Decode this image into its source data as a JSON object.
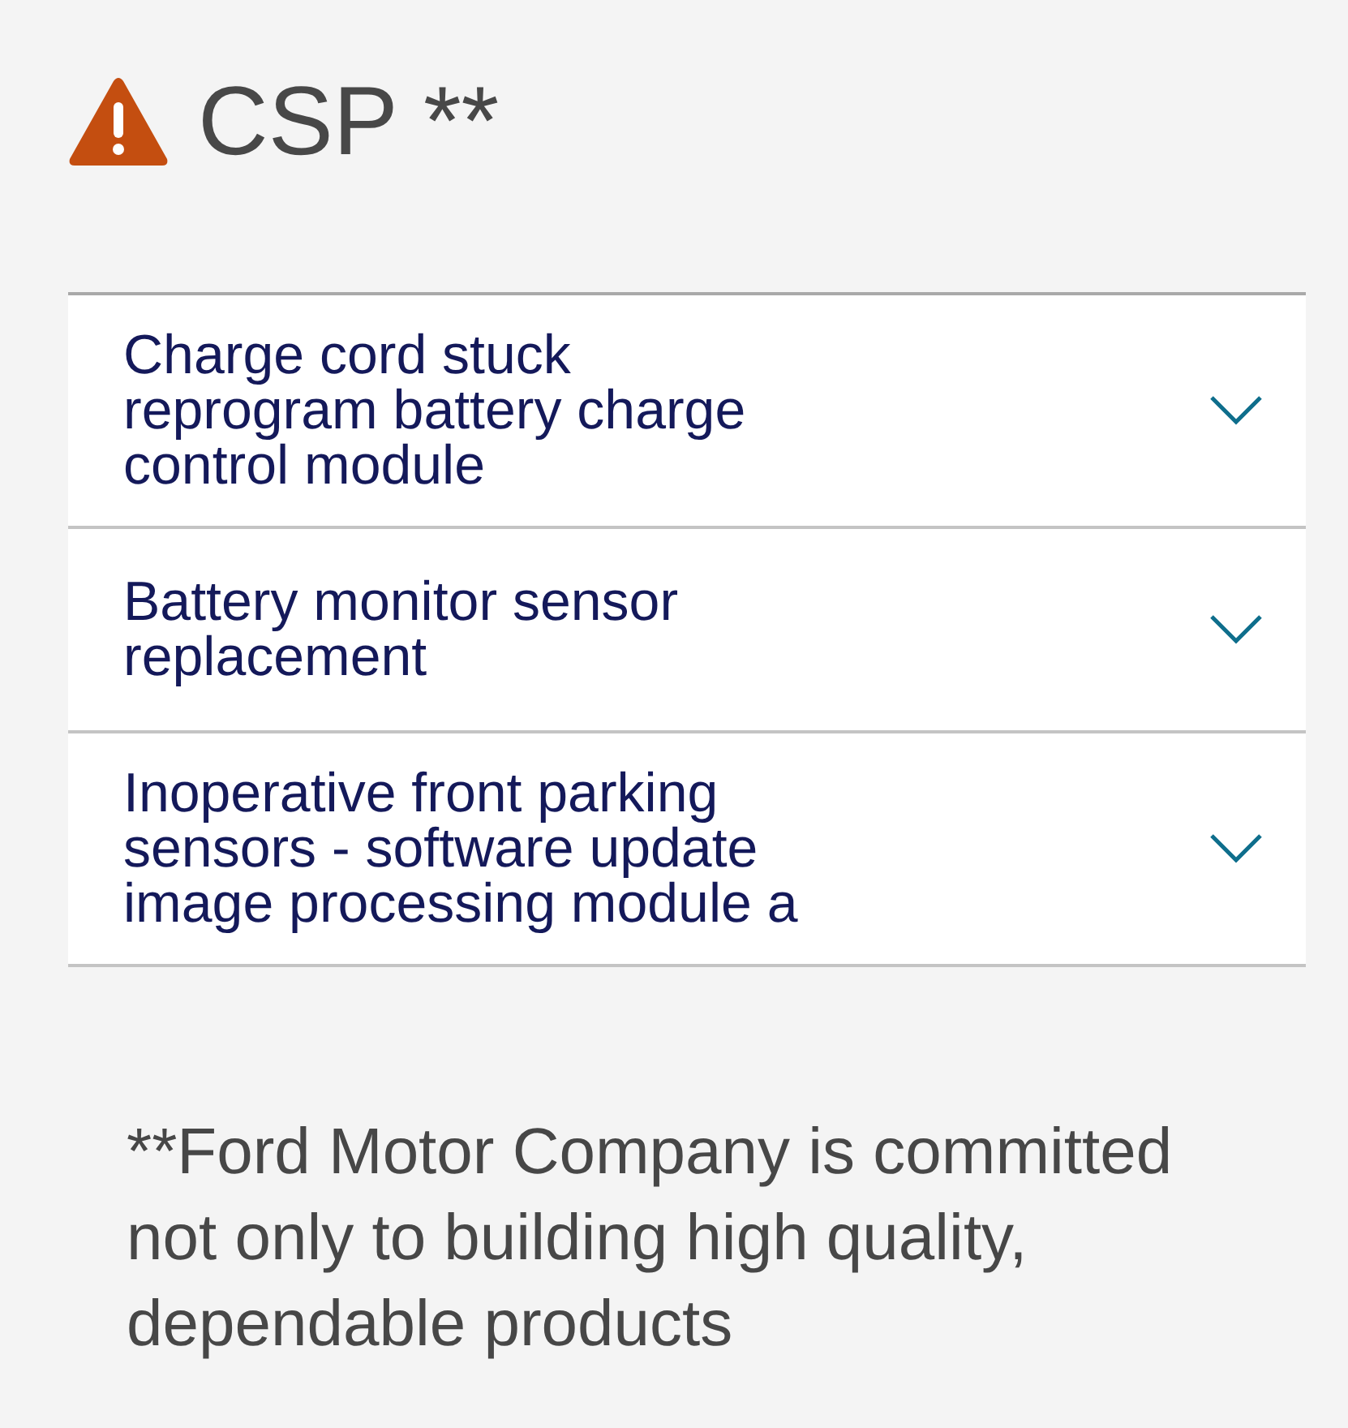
{
  "header": {
    "title": "CSP **"
  },
  "items": [
    {
      "label": "Charge cord stuck reprogram battery charge control module",
      "expanded": false
    },
    {
      "label": "Battery monitor sensor replacement",
      "expanded": false
    },
    {
      "label": "Inoperative front parking sensors - software update image processing module a",
      "expanded": false
    }
  ],
  "footnote": "**Ford Motor Company is committed not only to building high quality, dependable products"
}
